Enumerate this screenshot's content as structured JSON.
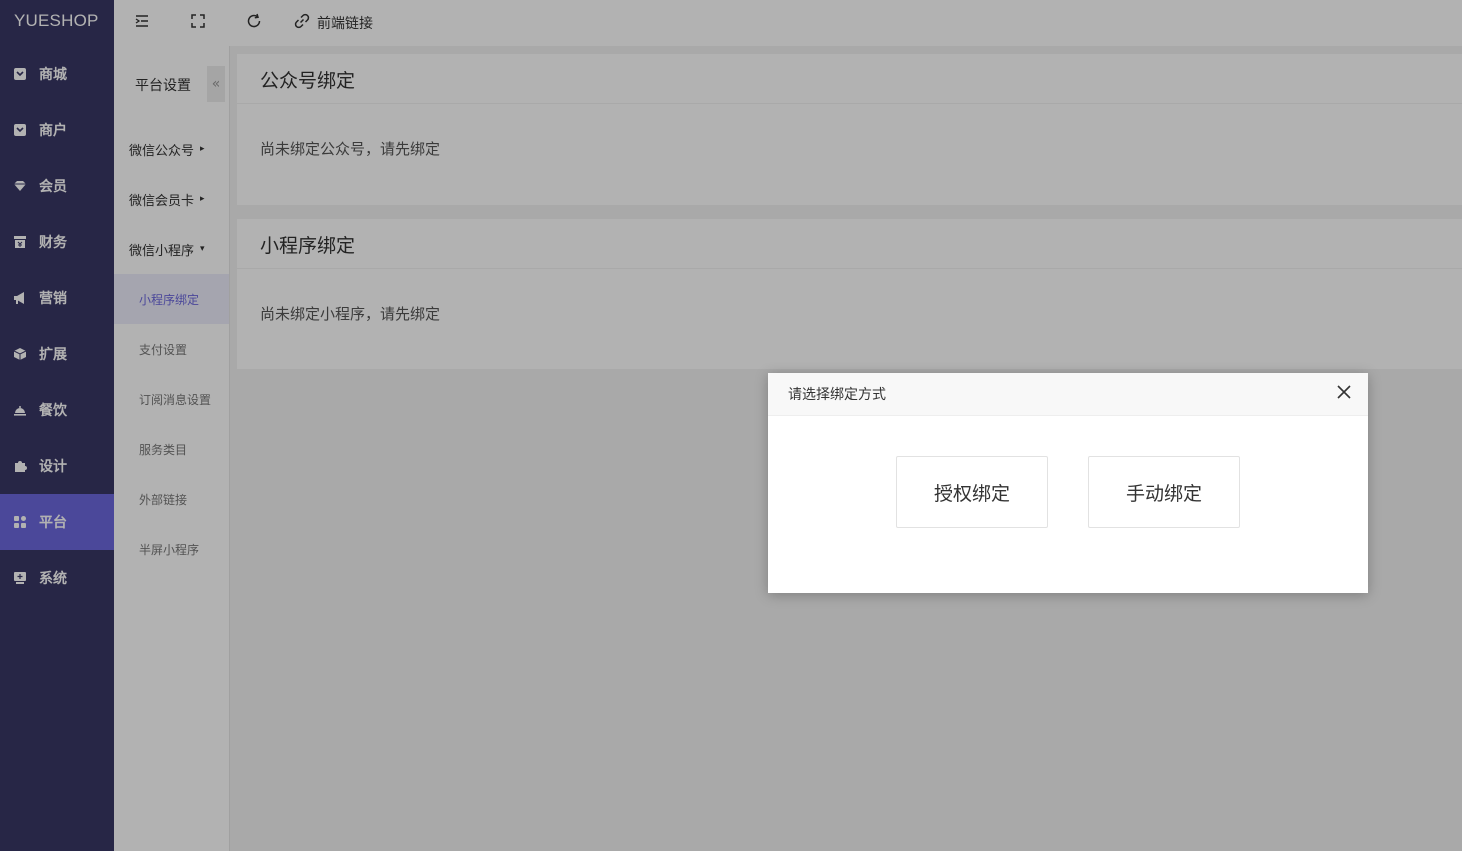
{
  "brand": "YUESHOP",
  "nav": [
    {
      "label": "商城",
      "icon": "shop-icon"
    },
    {
      "label": "商户",
      "icon": "merchant-icon"
    },
    {
      "label": "会员",
      "icon": "member-icon"
    },
    {
      "label": "财务",
      "icon": "finance-icon"
    },
    {
      "label": "营销",
      "icon": "megaphone-icon"
    },
    {
      "label": "扩展",
      "icon": "cube-icon"
    },
    {
      "label": "餐饮",
      "icon": "dining-icon"
    },
    {
      "label": "设计",
      "icon": "puzzle-icon"
    },
    {
      "label": "平台",
      "icon": "grid-icon",
      "active": true
    },
    {
      "label": "系统",
      "icon": "system-icon"
    }
  ],
  "topbar": {
    "frontend_link_label": "前端链接"
  },
  "subnav": {
    "title": "平台设置",
    "collapse_symbol": "«",
    "groups": [
      {
        "label": "微信公众号",
        "arrow": "▸"
      },
      {
        "label": "微信会员卡",
        "arrow": "▸"
      },
      {
        "label": "微信小程序",
        "arrow": "▾"
      }
    ],
    "items": [
      {
        "label": "小程序绑定",
        "active": true
      },
      {
        "label": "支付设置"
      },
      {
        "label": "订阅消息设置"
      },
      {
        "label": "服务类目"
      },
      {
        "label": "外部链接"
      },
      {
        "label": "半屏小程序"
      }
    ]
  },
  "cards": [
    {
      "title": "公众号绑定",
      "body": "尚未绑定公众号，请先绑定"
    },
    {
      "title": "小程序绑定",
      "body": "尚未绑定小程序，请先绑定"
    }
  ],
  "dialog": {
    "title": "请选择绑定方式",
    "auth_bind_label": "授权绑定",
    "manual_bind_label": "手动绑定"
  }
}
